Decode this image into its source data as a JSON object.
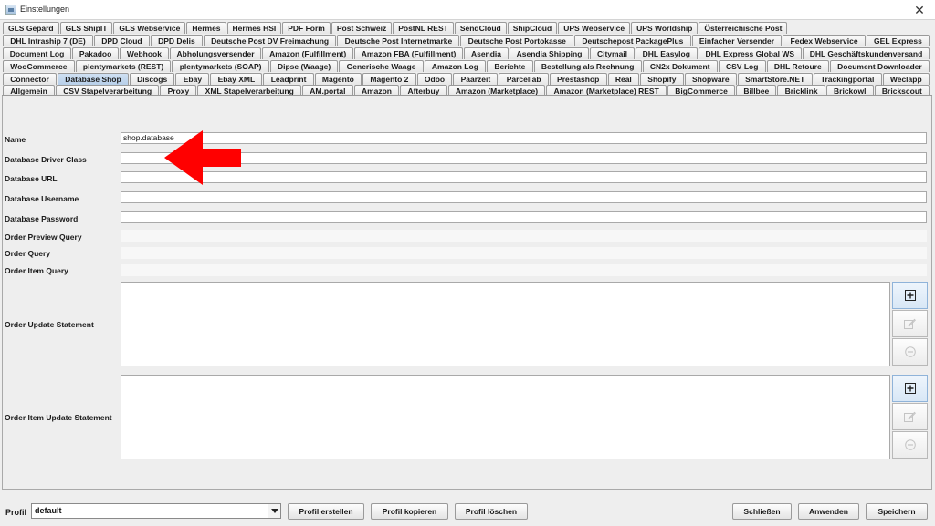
{
  "window": {
    "title": "Einstellungen",
    "close_glyph": "✕"
  },
  "tab_rows": [
    [
      "GLS Gepard",
      "GLS ShipIT",
      "GLS Webservice",
      "Hermes",
      "Hermes HSI",
      "PDF Form",
      "Post Schweiz",
      "PostNL REST",
      "SendCloud",
      "ShipCloud",
      "UPS Webservice",
      "UPS Worldship",
      "Österreichische Post"
    ],
    [
      "DHL Intraship 7 (DE)",
      "DPD Cloud",
      "DPD Delis",
      "Deutsche Post DV Freimachung",
      "Deutsche Post Internetmarke",
      "Deutsche Post Portokasse",
      "Deutschepost PackagePlus",
      "Einfacher Versender",
      "Fedex Webservice",
      "GEL Express"
    ],
    [
      "Document Log",
      "Pakadoo",
      "Webhook",
      "Abholungsversender",
      "Amazon (Fulfillment)",
      "Amazon FBA (Fulfillment)",
      "Asendia",
      "Asendia Shipping",
      "Citymail",
      "DHL Easylog",
      "DHL Express Global WS",
      "DHL Geschäftskundenversand"
    ],
    [
      "WooCommerce",
      "plentymarkets (REST)",
      "plentymarkets (SOAP)",
      "Dipse (Waage)",
      "Generische Waage",
      "Amazon Log",
      "Berichte",
      "Bestellung als Rechnung",
      "CN2x Dokument",
      "CSV Log",
      "DHL Retoure",
      "Document Downloader"
    ],
    [
      "Connector",
      "Database Shop",
      "Discogs",
      "Ebay",
      "Ebay XML",
      "Leadprint",
      "Magento",
      "Magento 2",
      "Odoo",
      "Paarzeit",
      "Parcellab",
      "Prestashop",
      "Real",
      "Shopify",
      "Shopware",
      "SmartStore.NET",
      "Trackingportal",
      "Weclapp"
    ],
    [
      "Allgemein",
      "CSV Stapelverarbeitung",
      "Proxy",
      "XML Stapelverarbeitung",
      "AM.portal",
      "Amazon",
      "Afterbuy",
      "Amazon (Marketplace)",
      "Amazon (Marketplace) REST",
      "BigCommerce",
      "Billbee",
      "Bricklink",
      "Brickowl",
      "Brickscout"
    ]
  ],
  "selected_tab": "Database Shop",
  "form": {
    "name_label": "Name",
    "name_value": "shop.database",
    "driver_label": "Database Driver Class",
    "driver_value": "",
    "url_label": "Database URL",
    "url_value": "",
    "username_label": "Database Username",
    "username_value": "",
    "password_label": "Database Password",
    "password_value": "",
    "preview_label": "Order Preview Query",
    "order_query_label": "Order Query",
    "item_query_label": "Order Item Query",
    "update_label": "Order Update Statement",
    "item_update_label": "Order Item Update Statement"
  },
  "icons": {
    "add": "plus-square-icon",
    "edit": "pencil-icon",
    "remove": "minus-circle-icon",
    "arrow_color": "#ff0000"
  },
  "footer": {
    "profil_label": "Profil",
    "profil_value": "default",
    "create": "Profil erstellen",
    "copy": "Profil kopieren",
    "delete": "Profil löschen",
    "close": "Schließen",
    "apply": "Anwenden",
    "save": "Speichern"
  }
}
